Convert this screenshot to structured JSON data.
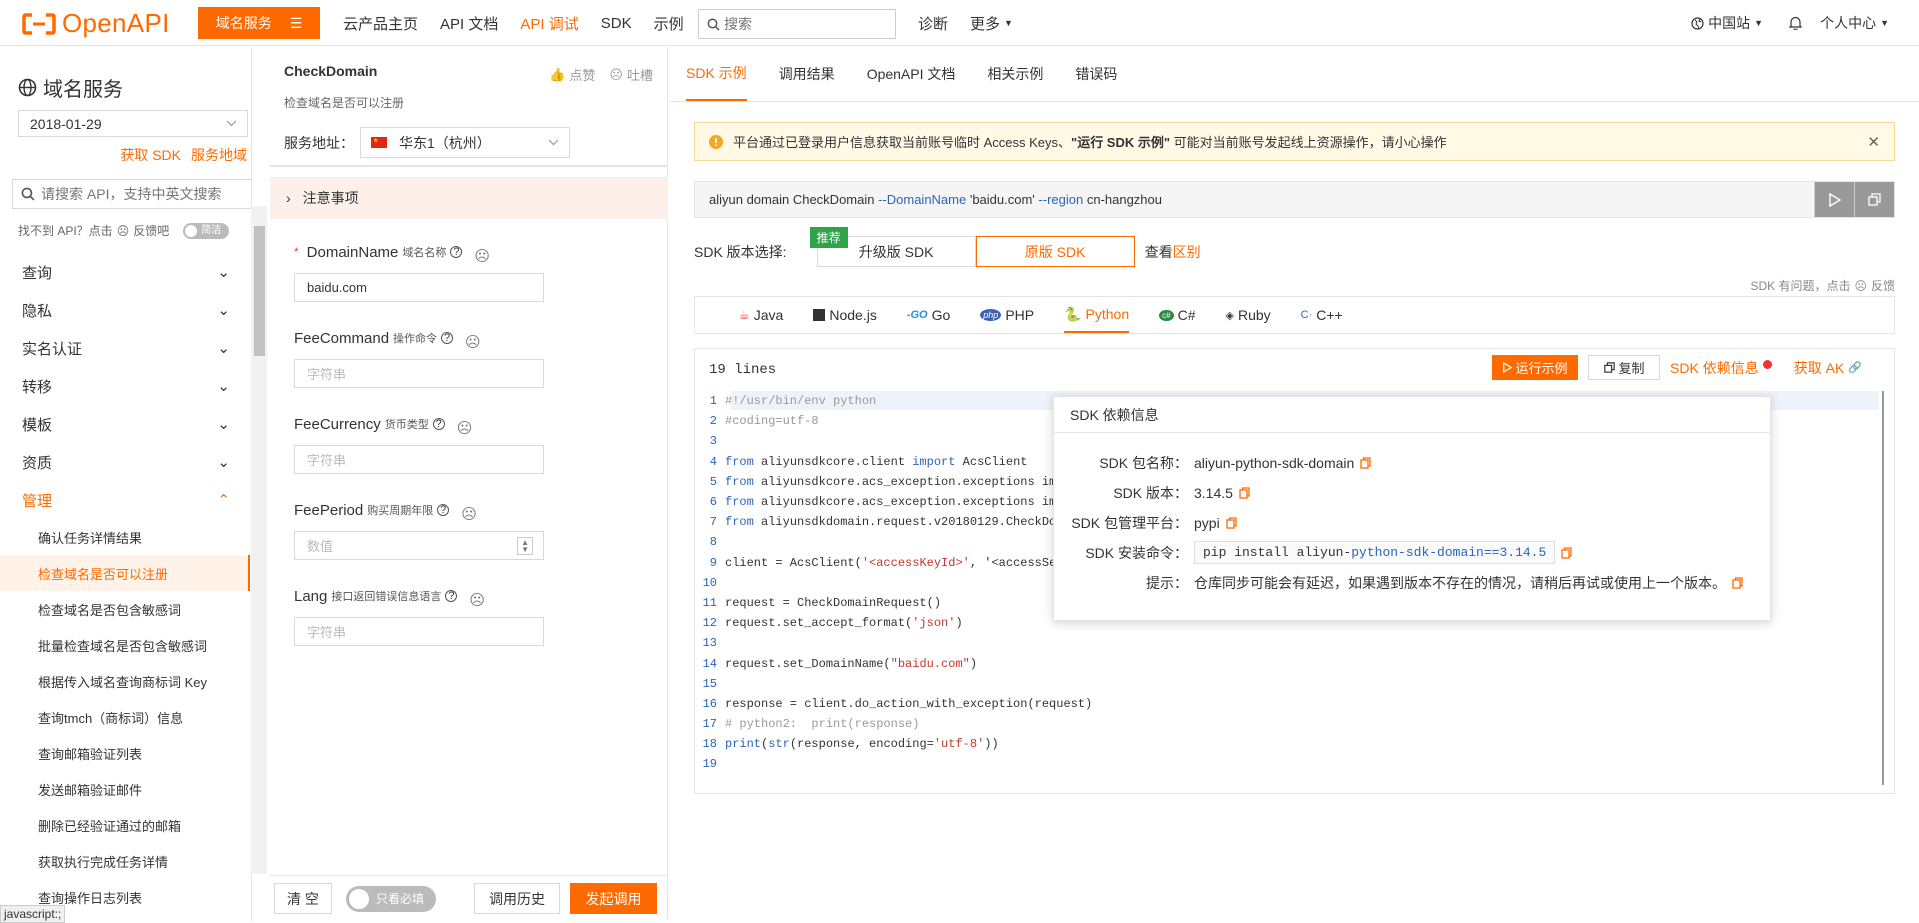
{
  "topbar": {
    "logo": "OpenAPI",
    "domain_service_btn": "域名服务",
    "nav": [
      "云产品主页",
      "API 文档",
      "API 调试",
      "SDK",
      "示例"
    ],
    "nav_active_index": 2,
    "search_placeholder": "搜索",
    "links": [
      "诊断",
      "更多"
    ],
    "region": "中国站",
    "user": "个人中心"
  },
  "sidebar": {
    "service_title": "域名服务",
    "version": "2018-01-29",
    "get_sdk": "获取 SDK",
    "service_region": "服务地域",
    "search_placeholder": "请搜索 API，支持中英文搜索",
    "feedback_text": "找不到 API？点击",
    "feedback_link": "反馈吧",
    "simple_toggle": "简洁",
    "categories": [
      "查询",
      "隐私",
      "实名认证",
      "转移",
      "模板",
      "资质"
    ],
    "open_category": "管理",
    "sub_items": [
      "确认任务详情结果",
      "检查域名是否可以注册",
      "检查域名是否包含敏感词",
      "批量检查域名是否包含敏感词",
      "根据传入域名查询商标词 Key",
      "查询tmch（商标词）信息",
      "查询邮箱验证列表",
      "发送邮箱验证邮件",
      "删除已经验证通过的邮箱",
      "获取执行完成任务详情",
      "查询操作日志列表"
    ],
    "active_sub_index": 1,
    "status": "javascript:;"
  },
  "middle": {
    "api_name": "CheckDomain",
    "api_desc": "检查域名是否可以注册",
    "like": "点赞",
    "dislike": "吐槽",
    "service_address_label": "服务地址：",
    "region_value": "华东1（杭州）",
    "notice": "注意事项",
    "params": [
      {
        "name": "DomainName",
        "desc": "域名名称",
        "value": "baidu.com",
        "placeholder": "",
        "required": true
      },
      {
        "name": "FeeCommand",
        "desc": "操作命令",
        "value": "",
        "placeholder": "字符串",
        "required": false
      },
      {
        "name": "FeeCurrency",
        "desc": "货币类型",
        "value": "",
        "placeholder": "字符串",
        "required": false
      },
      {
        "name": "FeePeriod",
        "desc": "购买周期年限",
        "value": "",
        "placeholder": "数值",
        "required": false
      },
      {
        "name": "Lang",
        "desc": "接口返回错误信息语言",
        "value": "",
        "placeholder": "字符串",
        "required": false
      }
    ],
    "clear_btn": "清 空",
    "required_only": "只看必填",
    "history_btn": "调用历史",
    "invoke_btn": "发起调用"
  },
  "right": {
    "tabs": [
      "SDK 示例",
      "调用结果",
      "OpenAPI 文档",
      "相关示例",
      "错误码"
    ],
    "active_tab": 0,
    "warning_prefix": "平台通过已登录用户信息获取当前账号临时 Access Keys、",
    "warning_bold": "\"运行 SDK 示例\"",
    "warning_suffix": " 可能对当前账号发起线上资源操作，请小心操作",
    "cli": {
      "cmd": "aliyun domain CheckDomain ",
      "flag1": "--DomainName",
      "val1": " 'baidu.com' ",
      "flag2": "--region",
      "val2": " cn-hangzhou"
    },
    "sdk_version_label": "SDK 版本选择:",
    "recommend_badge": "推荐",
    "sdk_upgrade": "升级版 SDK",
    "sdk_original": "原版 SDK",
    "view": "查看",
    "difference": "区别",
    "sdk_problem": "SDK 有问题，点击",
    "feedback": "反馈",
    "languages": [
      "Java",
      "Node.js",
      "Go",
      "PHP",
      "Python",
      "C#",
      "Ruby",
      "C++"
    ],
    "active_language": 4,
    "lines_label": "19 lines",
    "run_example": "运行示例",
    "copy": "复制",
    "sdk_deps": "SDK 依赖信息",
    "get_ak": "获取 AK"
  },
  "code_lines": [
    "#!/usr/bin/env python",
    "#coding=utf-8",
    "",
    "from aliyunsdkcore.client import AcsClient",
    "from aliyunsdkcore.acs_exception.exceptions im",
    "from aliyunsdkcore.acs_exception.exceptions im",
    "from aliyunsdkdomain.request.v20180129.CheckDo",
    "",
    "client = AcsClient('<accessKeyId>', '<accessSe",
    "",
    "request = CheckDomainRequest()",
    "request.set_accept_format('json')",
    "",
    "request.set_DomainName(\"baidu.com\")",
    "",
    "response = client.do_action_with_exception(request)",
    "# python2:  print(response)",
    "print(str(response, encoding='utf-8'))",
    ""
  ],
  "popup": {
    "title": "SDK 依赖信息",
    "pkg_label": "SDK 包名称：",
    "pkg_value": "aliyun-python-sdk-domain",
    "ver_label": "SDK 版本：",
    "ver_value": "3.14.5",
    "platform_label": "SDK 包管理平台：",
    "platform_value": "pypi",
    "install_label": "SDK 安装命令：",
    "install_prefix": "pip install aliyun-",
    "install_mid": "python-sdk-domain",
    "install_suffix": "==3.14.5",
    "tip_label": "提示：",
    "tip_value": "仓库同步可能会有延迟，如果遇到版本不存在的情况，请稍后再试或使用上一个版本。"
  },
  "colors": {
    "accent": "#ff6a00",
    "link_blue": "#2b65b9",
    "recommend_green": "#2fa24a"
  }
}
